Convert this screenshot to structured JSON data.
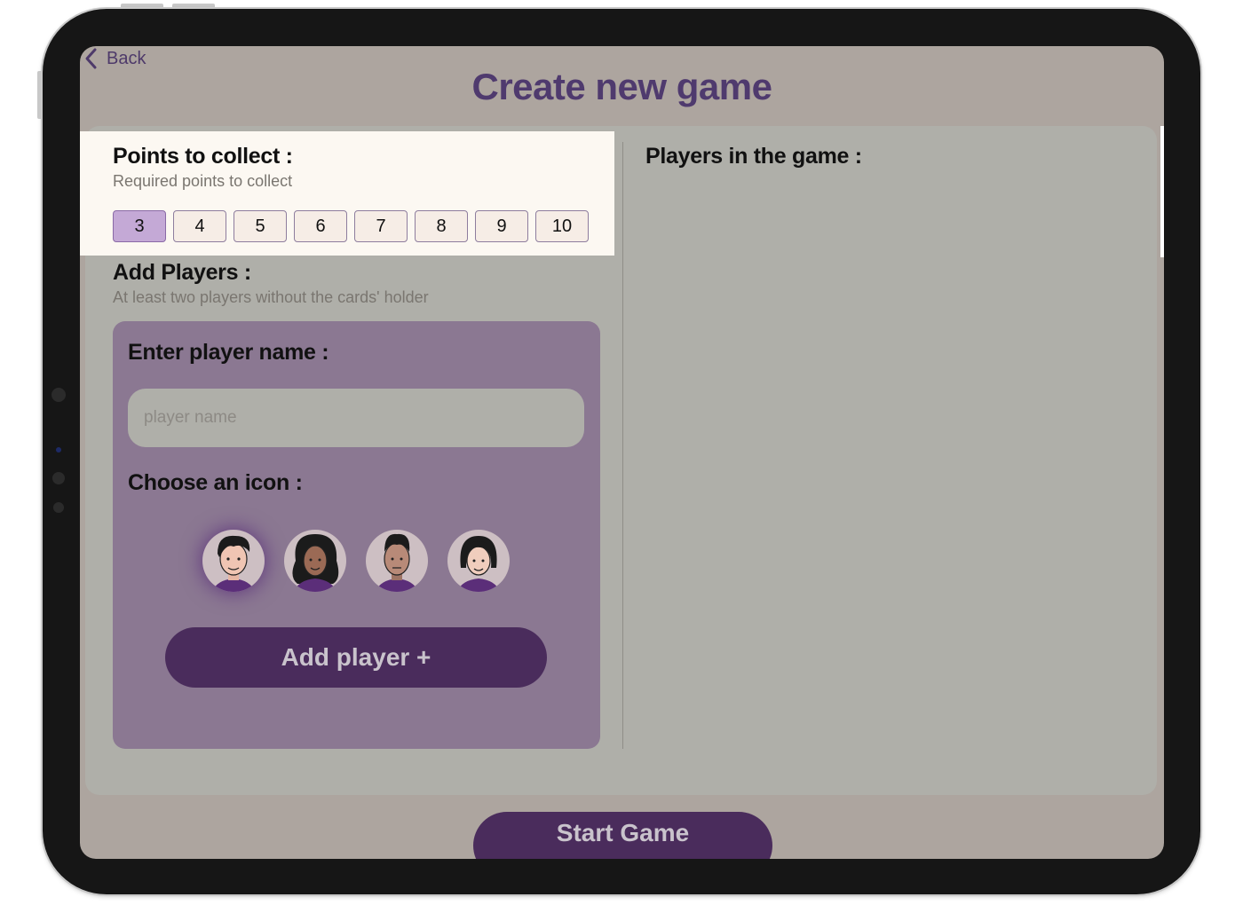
{
  "nav": {
    "back_label": "Back"
  },
  "page": {
    "title": "Create new game"
  },
  "points": {
    "heading": "Points to collect :",
    "subtitle": "Required points to collect",
    "options": [
      "3",
      "4",
      "5",
      "6",
      "7",
      "8",
      "9",
      "10"
    ],
    "selected": "3"
  },
  "add_players": {
    "heading": "Add Players :",
    "subtitle": "At least two players without the cards' holder"
  },
  "player_form": {
    "name_label": "Enter player name :",
    "name_placeholder": "player name",
    "name_value": "",
    "icon_label": "Choose an icon :",
    "icons": [
      "boy-avatar-icon",
      "girl-curly-avatar-icon",
      "man-avatar-icon",
      "girl-short-hair-avatar-icon"
    ],
    "selected_icon": "boy-avatar-icon",
    "add_button": "Add player +"
  },
  "players_list": {
    "heading": "Players in the game :",
    "players": []
  },
  "start_button": "Start Game",
  "colors": {
    "background": "#ada59f",
    "primary_dark": "#4a2c5c",
    "title": "#4f3a6e",
    "card": "#8b7892",
    "selected_point": "#c4a9d6",
    "highlight": "#fcf8f2"
  }
}
